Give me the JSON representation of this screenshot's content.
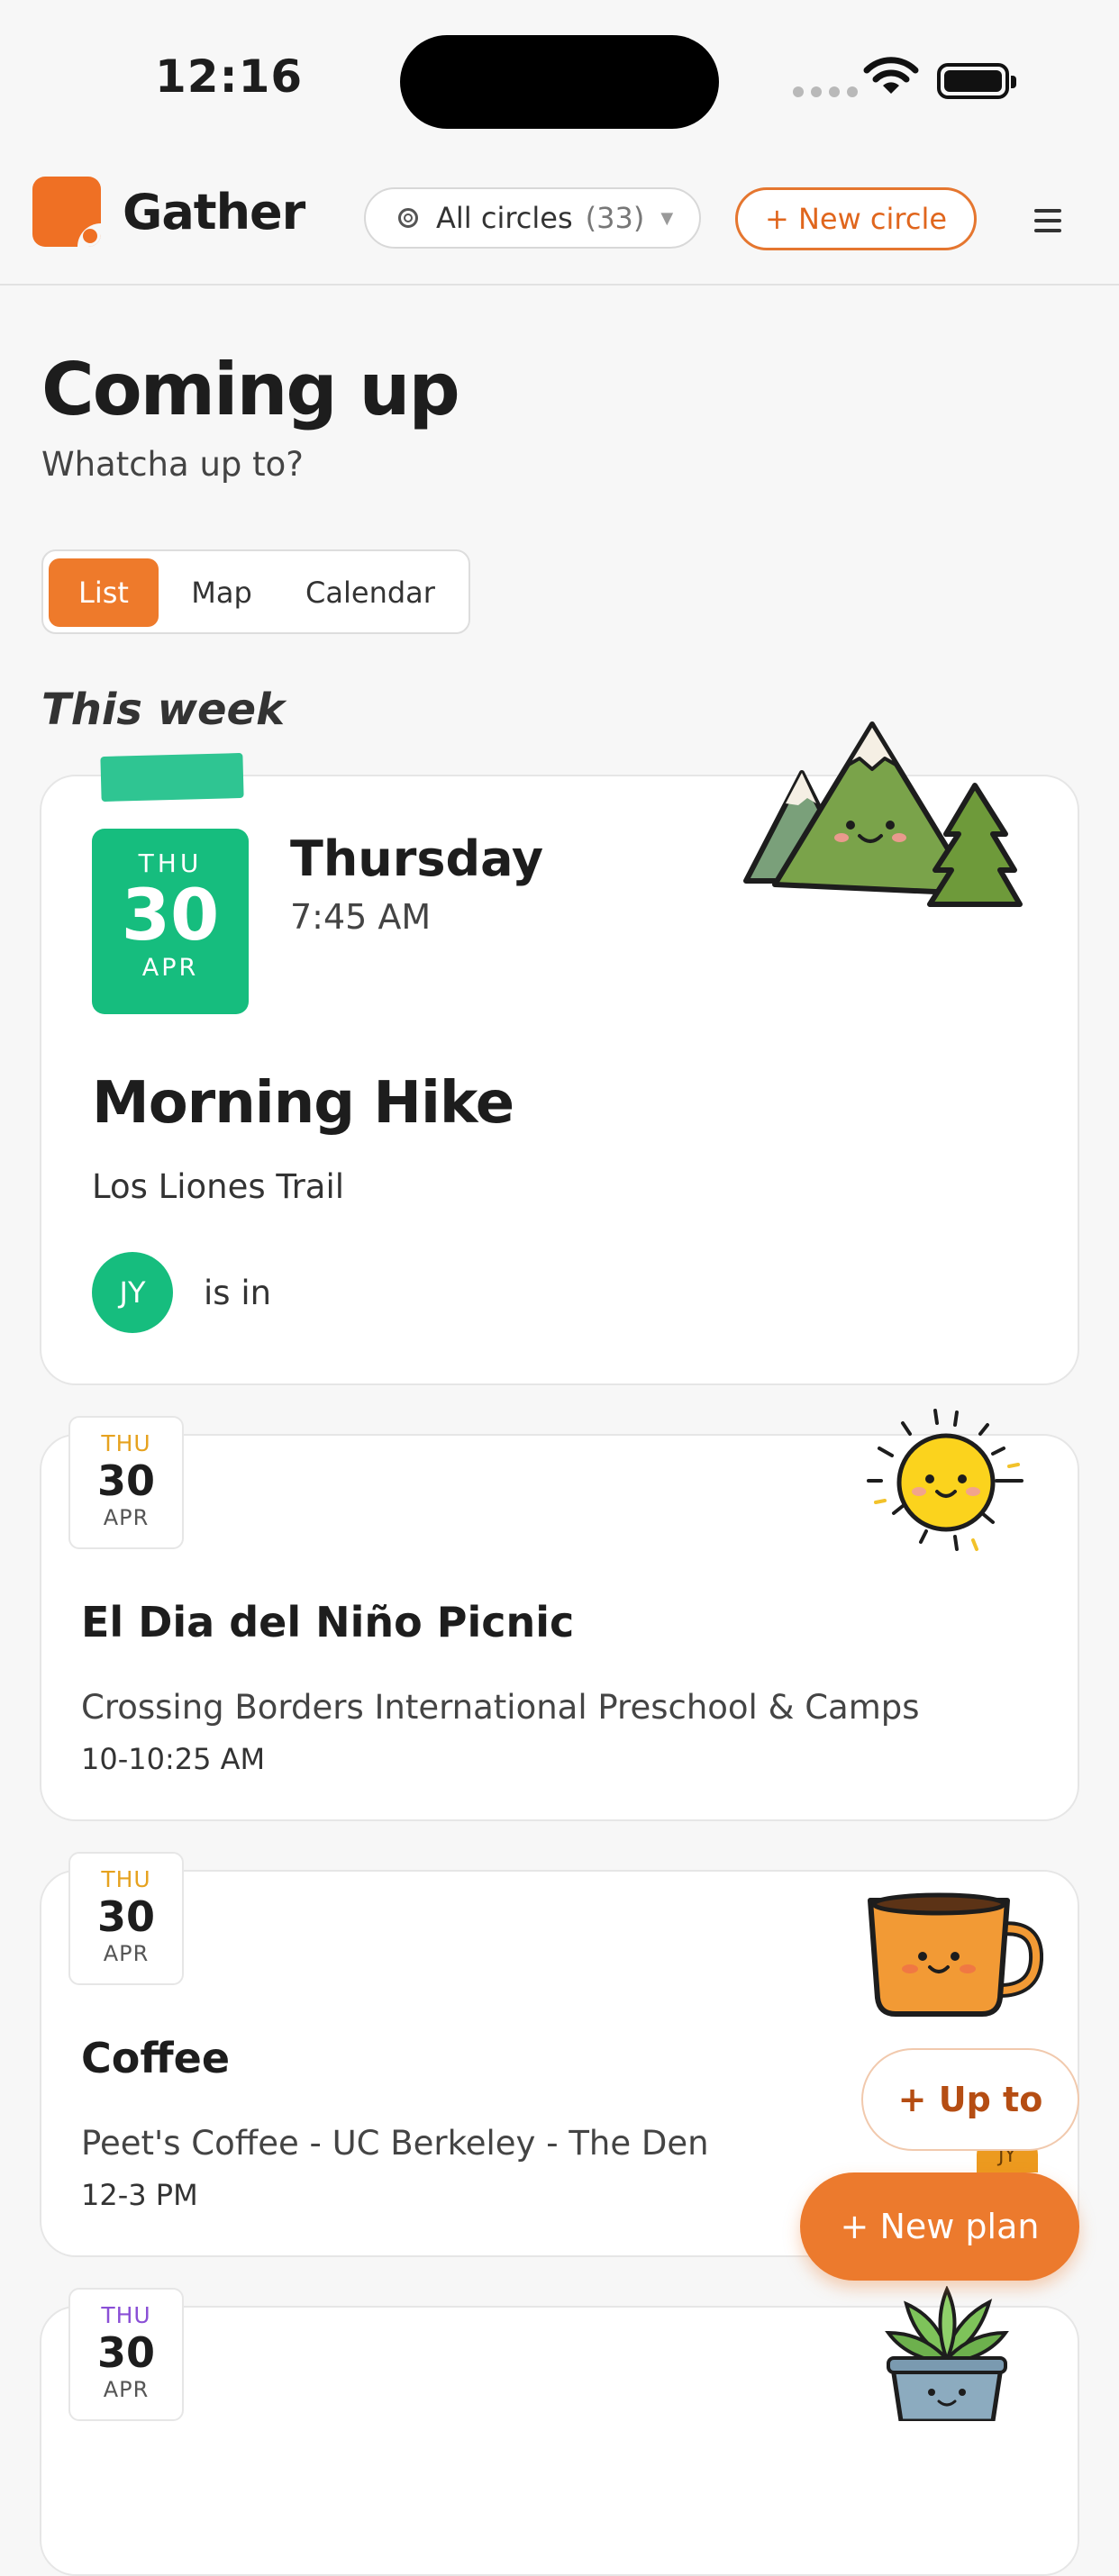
{
  "status": {
    "time": "12:16"
  },
  "header": {
    "app_name": "Gather",
    "circle_filter": {
      "label": "All circles",
      "count": "(33)"
    },
    "new_circle_label": "+ New circle"
  },
  "page": {
    "title": "Coming up",
    "subtitle": "Whatcha up to?"
  },
  "view_tabs": [
    {
      "label": "List",
      "active": true
    },
    {
      "label": "Map",
      "active": false
    },
    {
      "label": "Calendar",
      "active": false
    }
  ],
  "section_label": "This week",
  "featured_event": {
    "date": {
      "dow": "THU",
      "day": "30",
      "month": "APR"
    },
    "weekday": "Thursday",
    "time": "7:45 AM",
    "title": "Morning Hike",
    "location": "Los Liones Trail",
    "attendee_initials": "JY",
    "attendee_status": "is in",
    "illustration": "mountains-icon"
  },
  "events": [
    {
      "date": {
        "dow": "THU",
        "day": "30",
        "month": "APR"
      },
      "title": "El Dia del Niño Picnic",
      "location": "Crossing Borders International Preschool & Camps",
      "time": "10-10:25 AM",
      "illustration": "sun-icon"
    },
    {
      "date": {
        "dow": "THU",
        "day": "30",
        "month": "APR"
      },
      "title": "Coffee",
      "location": "Peet's Coffee - UC Berkeley - The Den",
      "time": "12-3 PM",
      "illustration": "coffee-mug-icon"
    },
    {
      "date": {
        "dow": "THU",
        "day": "30",
        "month": "APR"
      },
      "illustration": "potted-plant-icon"
    }
  ],
  "peek_badge": "JY",
  "fab": {
    "up_to_label": "+ Up to",
    "new_plan_label": "+ New plan"
  },
  "colors": {
    "brand": "#ef7024",
    "green": "#16bd7e",
    "accent_orange": "#ec7a2d"
  }
}
